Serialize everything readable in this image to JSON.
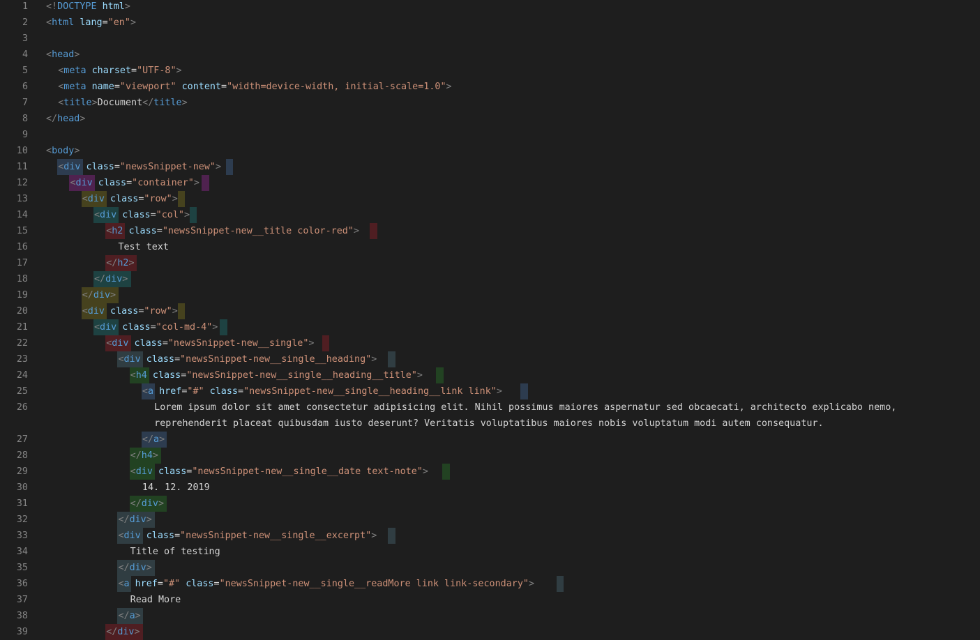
{
  "editor": {
    "lines": [
      {
        "n": "1",
        "indent": 0,
        "text": [
          [
            "p",
            "<!"
          ],
          [
            "t",
            "DOCTYPE "
          ],
          [
            "a",
            "html"
          ],
          [
            "p",
            ">"
          ]
        ]
      },
      {
        "n": "2",
        "indent": 0,
        "text": [
          [
            "p",
            "<"
          ],
          [
            "t",
            "html "
          ],
          [
            "a",
            "lang"
          ],
          [
            "x",
            "="
          ],
          [
            "v",
            "\"en\""
          ],
          [
            "p",
            ">"
          ]
        ]
      },
      {
        "n": "3",
        "indent": 0,
        "text": []
      },
      {
        "n": "4",
        "indent": 0,
        "text": [
          [
            "p",
            "<"
          ],
          [
            "t",
            "head"
          ],
          [
            "p",
            ">"
          ]
        ]
      },
      {
        "n": "5",
        "indent": 1,
        "text": [
          [
            "p",
            "<"
          ],
          [
            "t",
            "meta "
          ],
          [
            "a",
            "charset"
          ],
          [
            "x",
            "="
          ],
          [
            "v",
            "\"UTF-8\""
          ],
          [
            "p",
            ">"
          ]
        ]
      },
      {
        "n": "6",
        "indent": 1,
        "text": [
          [
            "p",
            "<"
          ],
          [
            "t",
            "meta "
          ],
          [
            "a",
            "name"
          ],
          [
            "x",
            "="
          ],
          [
            "v",
            "\"viewport\" "
          ],
          [
            "a",
            "content"
          ],
          [
            "x",
            "="
          ],
          [
            "v",
            "\"width=device-width, initial-scale=1.0\""
          ],
          [
            "p",
            ">"
          ]
        ]
      },
      {
        "n": "7",
        "indent": 1,
        "text": [
          [
            "p",
            "<"
          ],
          [
            "t",
            "title"
          ],
          [
            "p",
            ">"
          ],
          [
            "x",
            "Document"
          ],
          [
            "p",
            "</"
          ],
          [
            "t",
            "title"
          ],
          [
            "p",
            ">"
          ]
        ]
      },
      {
        "n": "8",
        "indent": 0,
        "text": [
          [
            "p",
            "</"
          ],
          [
            "t",
            "head"
          ],
          [
            "p",
            ">"
          ]
        ]
      },
      {
        "n": "9",
        "indent": 0,
        "text": []
      },
      {
        "n": "10",
        "indent": 0,
        "text": [
          [
            "p",
            "<"
          ],
          [
            "t",
            "body"
          ],
          [
            "p",
            ">"
          ]
        ]
      },
      {
        "n": "11",
        "indent": 1,
        "hl": "blue",
        "text": [
          [
            "p",
            "<"
          ],
          [
            "t",
            "div "
          ],
          [
            "a",
            "class"
          ],
          [
            "x",
            "="
          ],
          [
            "v",
            "\"newsSnippet-new\""
          ],
          [
            "p",
            ">"
          ]
        ]
      },
      {
        "n": "12",
        "indent": 2,
        "hl": "purple",
        "text": [
          [
            "p",
            "<"
          ],
          [
            "t",
            "div "
          ],
          [
            "a",
            "class"
          ],
          [
            "x",
            "="
          ],
          [
            "v",
            "\"container\""
          ],
          [
            "p",
            ">"
          ]
        ]
      },
      {
        "n": "13",
        "indent": 3,
        "hl": "olive",
        "text": [
          [
            "p",
            "<"
          ],
          [
            "t",
            "div "
          ],
          [
            "a",
            "class"
          ],
          [
            "x",
            "="
          ],
          [
            "v",
            "\"row\""
          ],
          [
            "p",
            ">"
          ]
        ]
      },
      {
        "n": "14",
        "indent": 4,
        "hl": "teal",
        "text": [
          [
            "p",
            "<"
          ],
          [
            "t",
            "div "
          ],
          [
            "a",
            "class"
          ],
          [
            "x",
            "="
          ],
          [
            "v",
            "\"col\""
          ],
          [
            "p",
            ">"
          ]
        ]
      },
      {
        "n": "15",
        "indent": 5,
        "hl": "red",
        "text": [
          [
            "p",
            "<"
          ],
          [
            "t",
            "h2 "
          ],
          [
            "a",
            "class"
          ],
          [
            "x",
            "="
          ],
          [
            "v",
            "\"newsSnippet-new__title color-red\""
          ],
          [
            "p",
            ">"
          ]
        ]
      },
      {
        "n": "16",
        "indent": 6,
        "text": [
          [
            "x",
            "Test text"
          ]
        ]
      },
      {
        "n": "17",
        "indent": 5,
        "hl": "red",
        "close": true,
        "text": [
          [
            "p",
            "</"
          ],
          [
            "t",
            "h2"
          ],
          [
            "p",
            ">"
          ]
        ]
      },
      {
        "n": "18",
        "indent": 4,
        "hl": "teal",
        "close": true,
        "text": [
          [
            "p",
            "</"
          ],
          [
            "t",
            "div"
          ],
          [
            "p",
            ">"
          ]
        ]
      },
      {
        "n": "19",
        "indent": 3,
        "hl": "olive",
        "close": true,
        "text": [
          [
            "p",
            "</"
          ],
          [
            "t",
            "div"
          ],
          [
            "p",
            ">"
          ]
        ]
      },
      {
        "n": "20",
        "indent": 3,
        "hl": "olive",
        "text": [
          [
            "p",
            "<"
          ],
          [
            "t",
            "div "
          ],
          [
            "a",
            "class"
          ],
          [
            "x",
            "="
          ],
          [
            "v",
            "\"row\""
          ],
          [
            "p",
            ">"
          ]
        ]
      },
      {
        "n": "21",
        "indent": 4,
        "hl": "teal",
        "text": [
          [
            "p",
            "<"
          ],
          [
            "t",
            "div "
          ],
          [
            "a",
            "class"
          ],
          [
            "x",
            "="
          ],
          [
            "v",
            "\"col-md-4\""
          ],
          [
            "p",
            ">"
          ]
        ]
      },
      {
        "n": "22",
        "indent": 5,
        "hl": "red",
        "text": [
          [
            "p",
            "<"
          ],
          [
            "t",
            "div "
          ],
          [
            "a",
            "class"
          ],
          [
            "x",
            "="
          ],
          [
            "v",
            "\"newsSnippet-new__single\""
          ],
          [
            "p",
            ">"
          ]
        ]
      },
      {
        "n": "23",
        "indent": 6,
        "hl": "slate",
        "text": [
          [
            "p",
            "<"
          ],
          [
            "t",
            "div "
          ],
          [
            "a",
            "class"
          ],
          [
            "x",
            "="
          ],
          [
            "v",
            "\"newsSnippet-new__single__heading\""
          ],
          [
            "p",
            ">"
          ]
        ]
      },
      {
        "n": "24",
        "indent": 7,
        "hl": "green",
        "text": [
          [
            "p",
            "<"
          ],
          [
            "t",
            "h4 "
          ],
          [
            "a",
            "class"
          ],
          [
            "x",
            "="
          ],
          [
            "v",
            "\"newsSnippet-new__single__heading__title\""
          ],
          [
            "p",
            ">"
          ]
        ]
      },
      {
        "n": "25",
        "indent": 8,
        "hl": "blue",
        "text": [
          [
            "p",
            "<"
          ],
          [
            "t",
            "a "
          ],
          [
            "a",
            "href"
          ],
          [
            "x",
            "="
          ],
          [
            "v",
            "\"#\" "
          ],
          [
            "a",
            "class"
          ],
          [
            "x",
            "="
          ],
          [
            "v",
            "\"newsSnippet-new__single__heading__link link\""
          ],
          [
            "p",
            ">"
          ]
        ]
      },
      {
        "n": "26",
        "indent": 9,
        "text": [
          [
            "x",
            "Lorem ipsum dolor sit amet consectetur adipisicing elit. Nihil possimus maiores aspernatur sed obcaecati, architecto explicabo nemo,"
          ]
        ]
      },
      {
        "n": "",
        "indent": 9,
        "text": [
          [
            "x",
            "reprehenderit placeat quibusdam iusto deserunt? Veritatis voluptatibus maiores nobis voluptatum modi autem consequatur."
          ]
        ]
      },
      {
        "n": "27",
        "indent": 8,
        "hl": "blue",
        "close": true,
        "text": [
          [
            "p",
            "</"
          ],
          [
            "t",
            "a"
          ],
          [
            "p",
            ">"
          ]
        ]
      },
      {
        "n": "28",
        "indent": 7,
        "hl": "green",
        "close": true,
        "text": [
          [
            "p",
            "</"
          ],
          [
            "t",
            "h4"
          ],
          [
            "p",
            ">"
          ]
        ]
      },
      {
        "n": "29",
        "indent": 7,
        "hl": "green",
        "text": [
          [
            "p",
            "<"
          ],
          [
            "t",
            "div "
          ],
          [
            "a",
            "class"
          ],
          [
            "x",
            "="
          ],
          [
            "v",
            "\"newsSnippet-new__single__date text-note\""
          ],
          [
            "p",
            ">"
          ]
        ]
      },
      {
        "n": "30",
        "indent": 8,
        "text": [
          [
            "x",
            "14. 12. 2019"
          ]
        ]
      },
      {
        "n": "31",
        "indent": 7,
        "hl": "green",
        "close": true,
        "text": [
          [
            "p",
            "</"
          ],
          [
            "t",
            "div"
          ],
          [
            "p",
            ">"
          ]
        ]
      },
      {
        "n": "32",
        "indent": 6,
        "hl": "slate",
        "close": true,
        "text": [
          [
            "p",
            "</"
          ],
          [
            "t",
            "div"
          ],
          [
            "p",
            ">"
          ]
        ]
      },
      {
        "n": "33",
        "indent": 6,
        "hl": "slate",
        "text": [
          [
            "p",
            "<"
          ],
          [
            "t",
            "div "
          ],
          [
            "a",
            "class"
          ],
          [
            "x",
            "="
          ],
          [
            "v",
            "\"newsSnippet-new__single__excerpt\""
          ],
          [
            "p",
            ">"
          ]
        ]
      },
      {
        "n": "34",
        "indent": 7,
        "text": [
          [
            "x",
            "Title of testing"
          ]
        ]
      },
      {
        "n": "35",
        "indent": 6,
        "hl": "slate",
        "close": true,
        "text": [
          [
            "p",
            "</"
          ],
          [
            "t",
            "div"
          ],
          [
            "p",
            ">"
          ]
        ]
      },
      {
        "n": "36",
        "indent": 6,
        "hl": "slate",
        "text": [
          [
            "p",
            "<"
          ],
          [
            "t",
            "a "
          ],
          [
            "a",
            "href"
          ],
          [
            "x",
            "="
          ],
          [
            "v",
            "\"#\" "
          ],
          [
            "a",
            "class"
          ],
          [
            "x",
            "="
          ],
          [
            "v",
            "\"newsSnippet-new__single__readMore link link-secondary\""
          ],
          [
            "p",
            ">"
          ]
        ]
      },
      {
        "n": "37",
        "indent": 7,
        "text": [
          [
            "x",
            "Read More"
          ]
        ]
      },
      {
        "n": "38",
        "indent": 6,
        "hl": "slate",
        "close": true,
        "text": [
          [
            "p",
            "</"
          ],
          [
            "t",
            "a"
          ],
          [
            "p",
            ">"
          ]
        ]
      },
      {
        "n": "39",
        "indent": 5,
        "hl": "red",
        "close": true,
        "text": [
          [
            "p",
            "</"
          ],
          [
            "t",
            "div"
          ],
          [
            "p",
            ">"
          ]
        ]
      }
    ]
  }
}
